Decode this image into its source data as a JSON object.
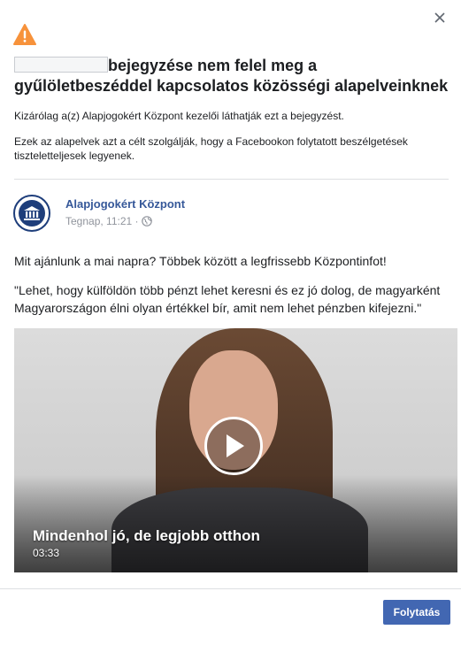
{
  "dialog": {
    "title_rest": "bejegyzése nem felel meg a gyűlöletbeszéddel kapcsolatos közösségi alapelveinknek",
    "visibility_text": "Kizárólag a(z) Alapjogokért Központ kezelői láthatják ezt a bejegyzést.",
    "purpose_text": "Ezek az alapelvek azt a célt szolgálják, hogy a Facebookon folytatott beszélgetések tiszteletteljesek legyenek.",
    "continue_label": "Folytatás"
  },
  "post": {
    "page_name": "Alapjogokért Központ",
    "timestamp": "Tegnap, 11:21 ·",
    "text_line1": "Mit ajánlunk a mai napra? Többek között a legfrissebb Központinfot!",
    "text_line2": "\"Lehet, hogy külföldön több pénzt lehet keresni és ez jó dolog, de magyarként Magyarországon élni olyan értékkel bír, amit nem lehet pénzben kifejezni.\""
  },
  "video": {
    "title": "Mindenhol jó, de legjobb otthon",
    "duration": "03:33"
  },
  "icons": {
    "warning": "warning-icon",
    "close": "close-icon",
    "globe": "globe-icon",
    "play": "play-icon",
    "avatar": "institution-icon"
  },
  "colors": {
    "accent": "#4267b2",
    "link": "#365899",
    "warning": "#f7923b"
  }
}
